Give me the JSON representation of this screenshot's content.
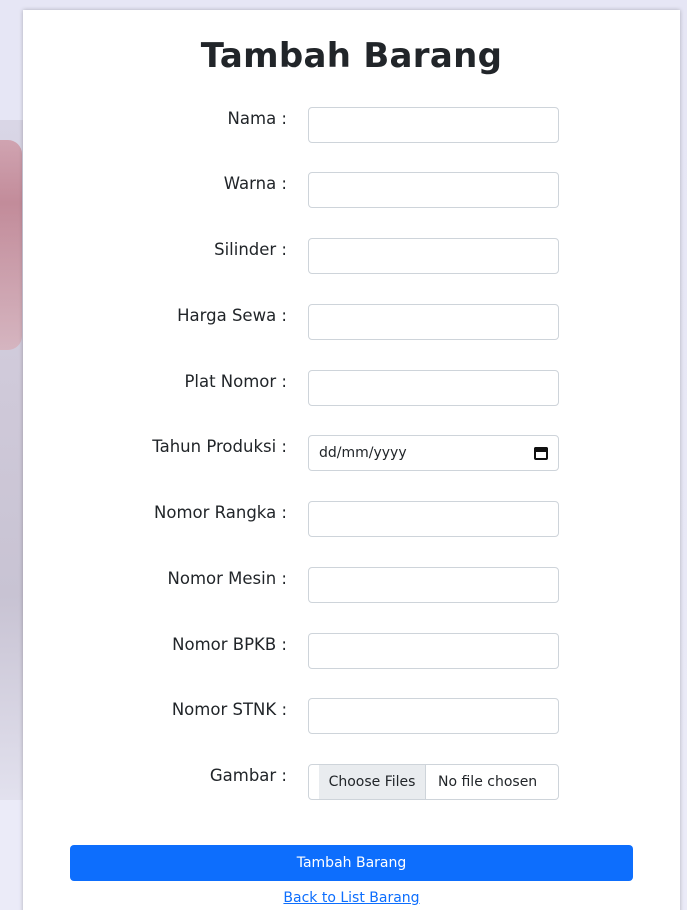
{
  "page": {
    "title": "Tambah Barang"
  },
  "form": {
    "fields": [
      {
        "label": "Nama :",
        "value": ""
      },
      {
        "label": "Warna :",
        "value": ""
      },
      {
        "label": "Silinder :",
        "value": ""
      },
      {
        "label": "Harga Sewa :",
        "value": ""
      },
      {
        "label": "Plat Nomor :",
        "value": ""
      },
      {
        "label": "Tahun Produksi :",
        "placeholder": "dd/mm/yyyy"
      },
      {
        "label": "Nomor Rangka :",
        "value": ""
      },
      {
        "label": "Nomor Mesin :",
        "value": ""
      },
      {
        "label": "Nomor BPKB :",
        "value": ""
      },
      {
        "label": "Nomor STNK :",
        "value": ""
      },
      {
        "label": "Gambar :",
        "button": "Choose Files",
        "status": "No file chosen"
      }
    ],
    "submit_label": "Tambah Barang",
    "back_link": "Back to List Barang"
  },
  "colors": {
    "primary": "#0d6efd",
    "background": "#e8e8f6"
  }
}
